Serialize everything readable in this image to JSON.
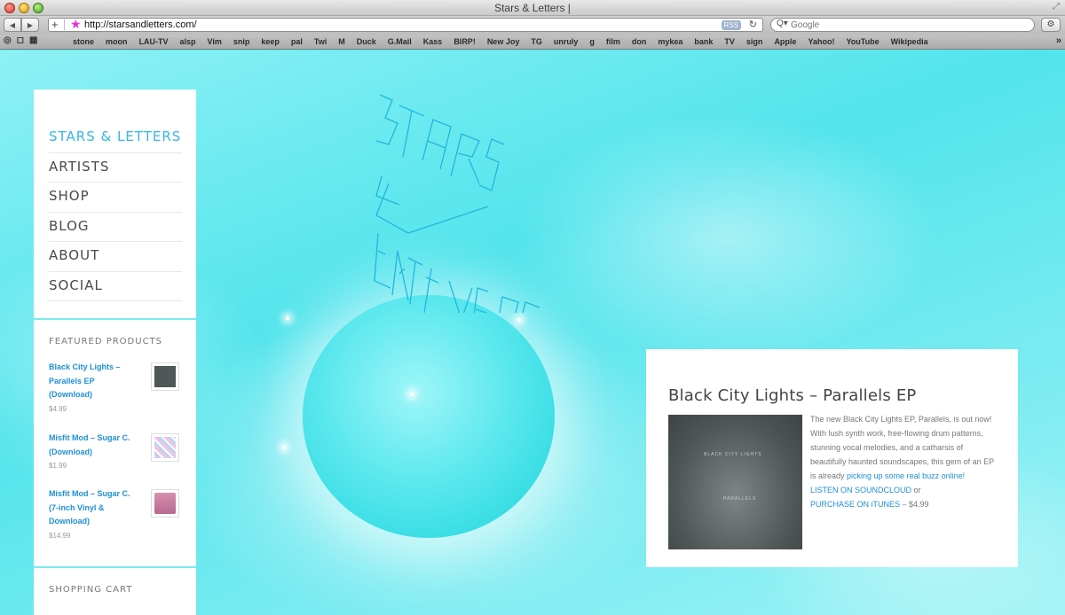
{
  "window": {
    "title": "Stars & Letters |"
  },
  "toolbar": {
    "url": "http://starsandletters.com/",
    "rss_label": "RSS",
    "search_placeholder": "Google"
  },
  "bookmarks": [
    "stone",
    "moon",
    "LAU-TV",
    "alsp",
    "Vim",
    "snip",
    "keep",
    "pal",
    "Twi",
    "M",
    "Duck",
    "G.Mail",
    "Kass",
    "BIRP!",
    "New Joy",
    "TG",
    "unruly",
    "g",
    "film",
    "don",
    "mykea",
    "bank",
    "TV",
    "sign",
    "Apple",
    "Yahoo!",
    "YouTube",
    "Wikipedia"
  ],
  "sidebar": {
    "nav": [
      "STARS & LETTERS",
      "ARTISTS",
      "SHOP",
      "BLOG",
      "ABOUT",
      "SOCIAL"
    ],
    "featured_title": "FEATURED PRODUCTS",
    "products": [
      {
        "name": "Black City Lights – Parallels EP (Download)",
        "price": "$4.99"
      },
      {
        "name": "Misfit Mod – Sugar C. (Download)",
        "price": "$1.99"
      },
      {
        "name": "Misfit Mod – Sugar C. (7-inch Vinyl & Download)",
        "price": "$14.99"
      }
    ],
    "cart_title": "SHOPPING CART"
  },
  "feature": {
    "title": "Black City Lights – Parallels EP",
    "cover_text_1": "BLACK CITY LIGHTS",
    "cover_text_2": "PARALLELS",
    "body_text": "The new Black City Lights EP, Parallels, is out now!  With lush synth work, free-flowing drum patterns, stunning vocal melodies, and a catharsis of beautifully haunted soundscapes, this gem of an EP is already ",
    "buzz_link": "picking up some real buzz online!",
    "soundcloud_link": "LISTEN ON SOUNDCLOUD",
    "or_text": " or",
    "itunes_link": "PURCHASE ON iTUNES",
    "price_text": " – $4.99"
  }
}
